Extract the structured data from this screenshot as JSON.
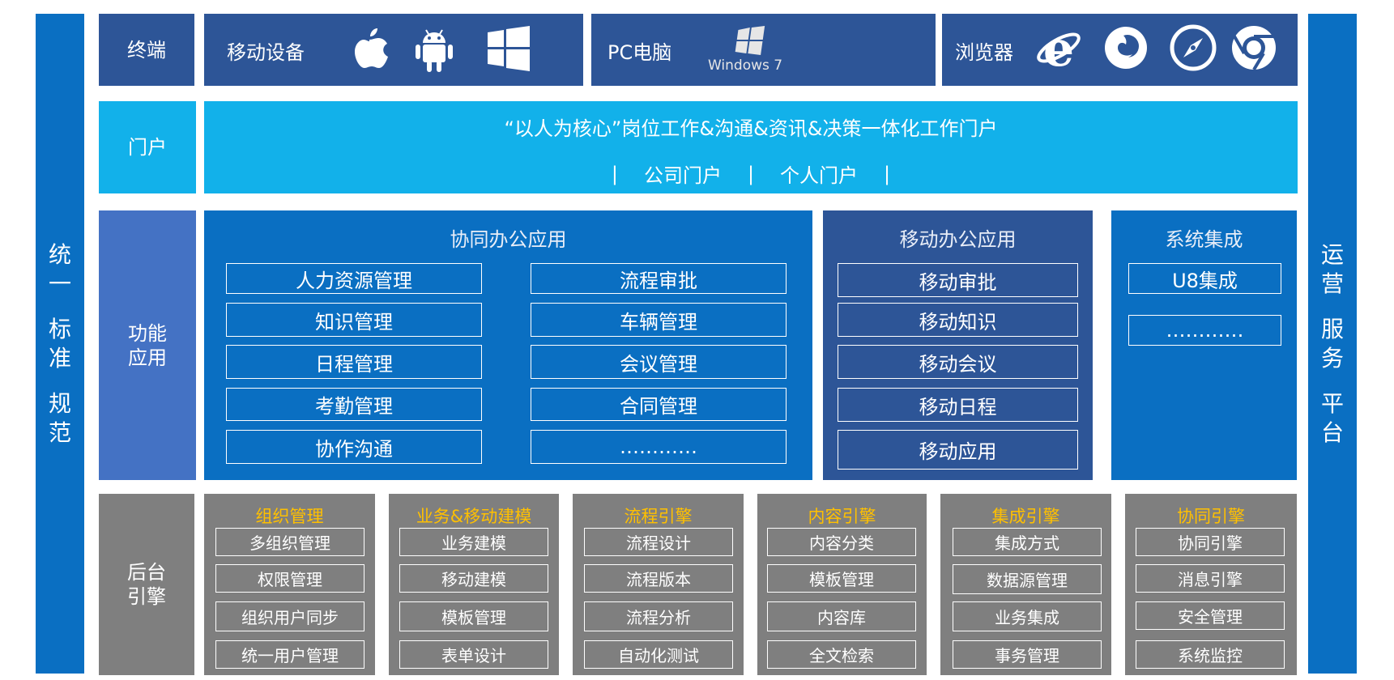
{
  "left_bar": [
    "统一",
    "标准",
    "规范"
  ],
  "right_bar": [
    "运营",
    "服务",
    "平台"
  ],
  "terminal": {
    "label": "终端",
    "mobile": "移动设备",
    "pc": "PC电脑",
    "windows_logo_text": "Windows 7",
    "browser": "浏览器",
    "icons": [
      "apple-icon",
      "android-icon",
      "windows-icon",
      "windows7-logo-icon",
      "ie-icon",
      "firefox-icon",
      "safari-icon",
      "chrome-icon"
    ]
  },
  "portal": {
    "label": "门户",
    "headline": "“以人为核心”岗位工作&沟通&资讯&决策一体化工作门户",
    "sep": "|",
    "company": "公司门户",
    "personal": "个人门户"
  },
  "function": {
    "label": "功能应用",
    "collab": {
      "title": "协同办公应用",
      "left": [
        "人力资源管理",
        "知识管理",
        "日程管理",
        "考勤管理",
        "协作沟通"
      ],
      "right": [
        "流程审批",
        "车辆管理",
        "会议管理",
        "合同管理",
        "…………"
      ]
    },
    "mobile": {
      "title": "移动办公应用",
      "items": [
        "移动审批",
        "移动知识",
        "移动会议",
        "移动日程",
        "移动应用"
      ]
    },
    "integration": {
      "title": "系统集成",
      "items": [
        "U8集成",
        "…………"
      ]
    }
  },
  "backend": {
    "label": "后台引擎",
    "groups": [
      {
        "title": "组织管理",
        "items": [
          "多组织管理",
          "权限管理",
          "组织用户同步",
          "统一用户管理"
        ]
      },
      {
        "title": "业务&移动建模",
        "items": [
          "业务建模",
          "移动建模",
          "模板管理",
          "表单设计"
        ]
      },
      {
        "title": "流程引擎",
        "items": [
          "流程设计",
          "流程版本",
          "流程分析",
          "自动化测试"
        ]
      },
      {
        "title": "内容引擎",
        "items": [
          "内容分类",
          "模板管理",
          "内容库",
          "全文检索"
        ]
      },
      {
        "title": "集成引擎",
        "items": [
          "集成方式",
          "数据源管理",
          "业务集成",
          "事务管理"
        ]
      },
      {
        "title": "协同引擎",
        "items": [
          "协同引擎",
          "消息引擎",
          "安全管理",
          "系统监控"
        ]
      }
    ]
  },
  "colors": {
    "side_bar": "#0a6fc2",
    "terminal": "#2d5597",
    "portal": "#12b1ea",
    "function_label": "#4472c4",
    "collab": "#0a6fc2",
    "mobile": "#2d5597",
    "backend": "#7f7f7f",
    "backend_title": "#ffc000"
  }
}
